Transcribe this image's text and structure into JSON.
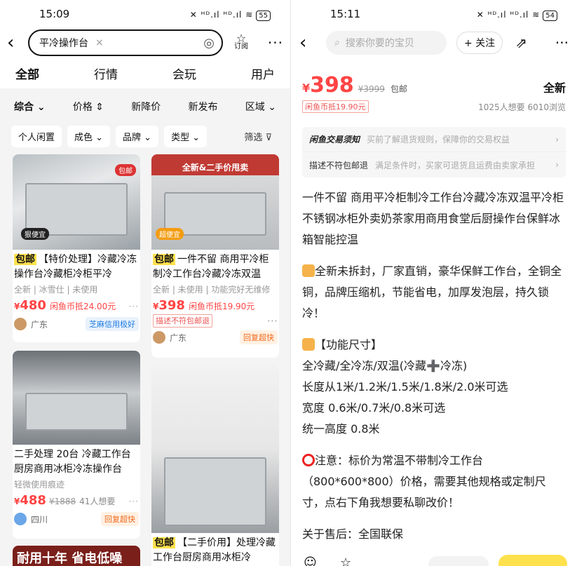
{
  "left": {
    "status": {
      "time": "15:09",
      "icons": "✕ ᴴᴰ.ıl ᴴᴰ.ıl ≋",
      "battery": "55"
    },
    "search": {
      "query": "平冷操作台",
      "clear": "×",
      "camera": "◎",
      "subscribe": "订阅",
      "more": "···"
    },
    "tabs": [
      "全部",
      "行情",
      "会玩",
      "用户"
    ],
    "filters": [
      "综合 ⌄",
      "价格 ⇕",
      "新降价",
      "新发布",
      "区域 ⌄"
    ],
    "chips": [
      "个人闲置",
      "成色 ⌄",
      "品牌 ⌄",
      "类型 ⌄"
    ],
    "chips_filter": "筛选 ⊽",
    "items": [
      {
        "tag": "包邮",
        "title": "【特价处理】冷藏冷冻操作台冷藏柜冷柜平冷",
        "meta": "全新 | 冰雪仕 | 未使用",
        "price": "480",
        "offset": "闲鱼币抵24.00元",
        "loc": "广东",
        "right": "芝麻信用极好",
        "badge": "包邮",
        "sticker": "狠便宜"
      },
      {
        "tag": "包邮",
        "title": "一件不留 商用平冷柜制冷工作台冷藏冷冻双温",
        "meta": "全新 | 未使用 | 功能完好无维修",
        "price": "398",
        "offset": "闲鱼币抵19.90元",
        "badge2": "描述不符包邮退",
        "loc": "广东",
        "right": "回复超快",
        "ribbon": "全新&二手价甩卖",
        "sticker": "超便宜"
      },
      {
        "title": "二手处理 20台 冷藏工作台厨房商用冰柜冷冻操作台",
        "meta": "轻微使用痕迹",
        "price": "488",
        "orig": "¥1888",
        "want": "41人想要",
        "loc": "四川",
        "right": "回复超快"
      },
      {
        "tag": "包邮",
        "title": "【二手价用】处理冷藏工作台厨房商用冰柜冷"
      },
      {
        "banner": "耐用十年 省电低噪"
      }
    ]
  },
  "right": {
    "status": {
      "time": "15:11",
      "icons": "✕ ᴴᴰ.ıl ᴴᴰ.ıl ≋",
      "battery": "54"
    },
    "search_placeholder": "搜索你要的宝贝",
    "follow": "+ 关注",
    "price": "398",
    "orig": "¥3999",
    "baoyou": "包邮",
    "condition": "全新",
    "offset": "闲鱼币抵19.90元",
    "stats": "1025人想要  6010浏览",
    "notice_title": "闲鱼交易须知",
    "notice_text": "买前了解退货规则，保障你的交易权益",
    "refund_title": "描述不符包邮退",
    "refund_text": "满足条件时，买家可退货且运费由卖家承担",
    "desc": [
      "一件不留 商用平冷柜制冷工作台冷藏冷冻双温平冷柜不锈钢冰柜外卖奶茶家用商用食堂后厨操作台保鲜冰箱智能控温",
      "全新未拆封，厂家直销，豪华保鲜工作台，全铜全铜，品牌压缩机，节能省电，加厚发泡层，持久锁冷！",
      "【功能尺寸】",
      "全冷藏/全冷冻/双温(冷藏➕冷冻)",
      "长度从1米/1.2米/1.5米/1.8米/2.0米可选",
      "宽度 0.6米/0.7米/0.8米可选",
      "统一高度 0.8米",
      "注意：标价为常温不带制冷工作台（800*600*800）价格，需要其他规格或定制尺寸，点右下角我想要私聊改价！",
      "关于售后：全国联保"
    ]
  }
}
